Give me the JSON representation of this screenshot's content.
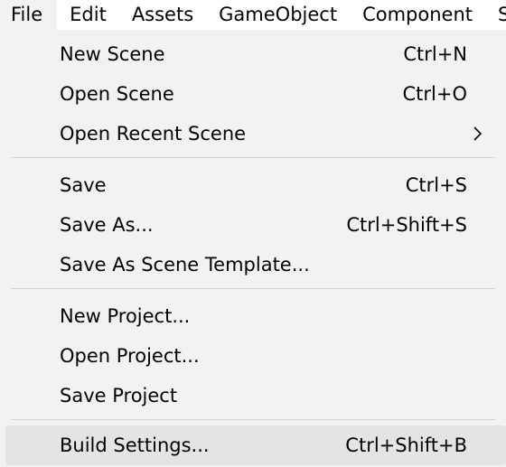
{
  "menubar": {
    "items": [
      "File",
      "Edit",
      "Assets",
      "GameObject",
      "Component",
      "S"
    ],
    "active": "File"
  },
  "file_menu": {
    "new_scene": {
      "label": "New Scene",
      "shortcut": "Ctrl+N"
    },
    "open_scene": {
      "label": "Open Scene",
      "shortcut": "Ctrl+O"
    },
    "open_recent_scene": {
      "label": "Open Recent Scene",
      "submenu_icon": "chevron-right-icon"
    },
    "save": {
      "label": "Save",
      "shortcut": "Ctrl+S"
    },
    "save_as": {
      "label": "Save As...",
      "shortcut": "Ctrl+Shift+S"
    },
    "save_as_scene_template": {
      "label": "Save As Scene Template..."
    },
    "new_project": {
      "label": "New Project..."
    },
    "open_project": {
      "label": "Open Project..."
    },
    "save_project": {
      "label": "Save Project"
    },
    "build_settings": {
      "label": "Build Settings...",
      "shortcut": "Ctrl+Shift+B"
    }
  },
  "colors": {
    "menu_background": "#f2f2f2",
    "menubar_background": "#ffffff",
    "hover_background": "#e4e4e4",
    "separator": "#d4d4d4"
  }
}
